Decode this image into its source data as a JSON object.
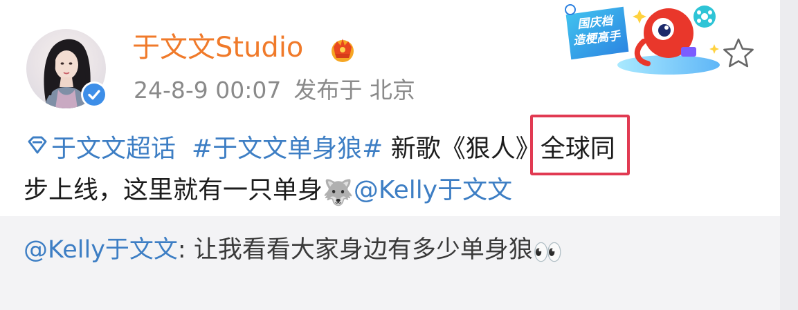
{
  "post": {
    "author": "于文文Studio",
    "timestamp": "24-8-9 00:07",
    "location": "发布于 北京",
    "avatar_icon": "avatar-photo",
    "verified_icon": "verified-check-icon",
    "crown_icon": "vip-crown-icon",
    "sticker": {
      "line1": "国庆档",
      "line2": "造梗高手"
    },
    "favorite_icon": "star-outline-icon",
    "content": {
      "super_topic": "于文文超话",
      "hashtag": "#于文文单身狼#",
      "text1": " 新歌",
      "song_title": "《狠人》",
      "text2": "全球同",
      "text3": "步上线，这里就有一只单身",
      "wolf_emoji": "🐺",
      "mention": "@Kelly于文文"
    }
  },
  "repost": {
    "mention": "@Kelly于文文",
    "separator": ": ",
    "text": "让我看看大家身边有多少单身狼",
    "eyes_emoji": "👀"
  },
  "colors": {
    "username": "#f07a2a",
    "link": "#3d7ec4",
    "highlight_box": "#e13a52",
    "meta": "#8a8a8a"
  }
}
